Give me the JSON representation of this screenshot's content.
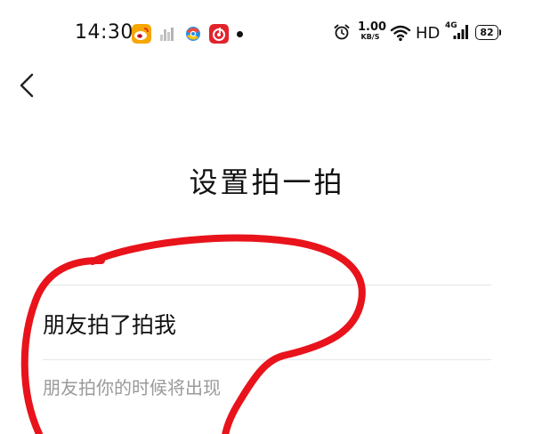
{
  "status_bar": {
    "time": "14:30",
    "app_icons": [
      "weibo-icon",
      "city-app-icon",
      "browser-icon",
      "music-app-icon"
    ],
    "network_speed_value": "1.00",
    "network_speed_unit": "KB/S",
    "hd_label": "HD",
    "signal_label": "4G",
    "battery": "82"
  },
  "nav": {
    "back_icon": "chevron-left-icon"
  },
  "page": {
    "title": "设置拍一拍"
  },
  "setting": {
    "label": "朋友拍了拍我",
    "placeholder": "朋友拍你的时候将出现"
  },
  "colors": {
    "annotation_red": "#e8131b",
    "divider": "#e6e6e6",
    "hint_text": "#9a9a9a"
  }
}
